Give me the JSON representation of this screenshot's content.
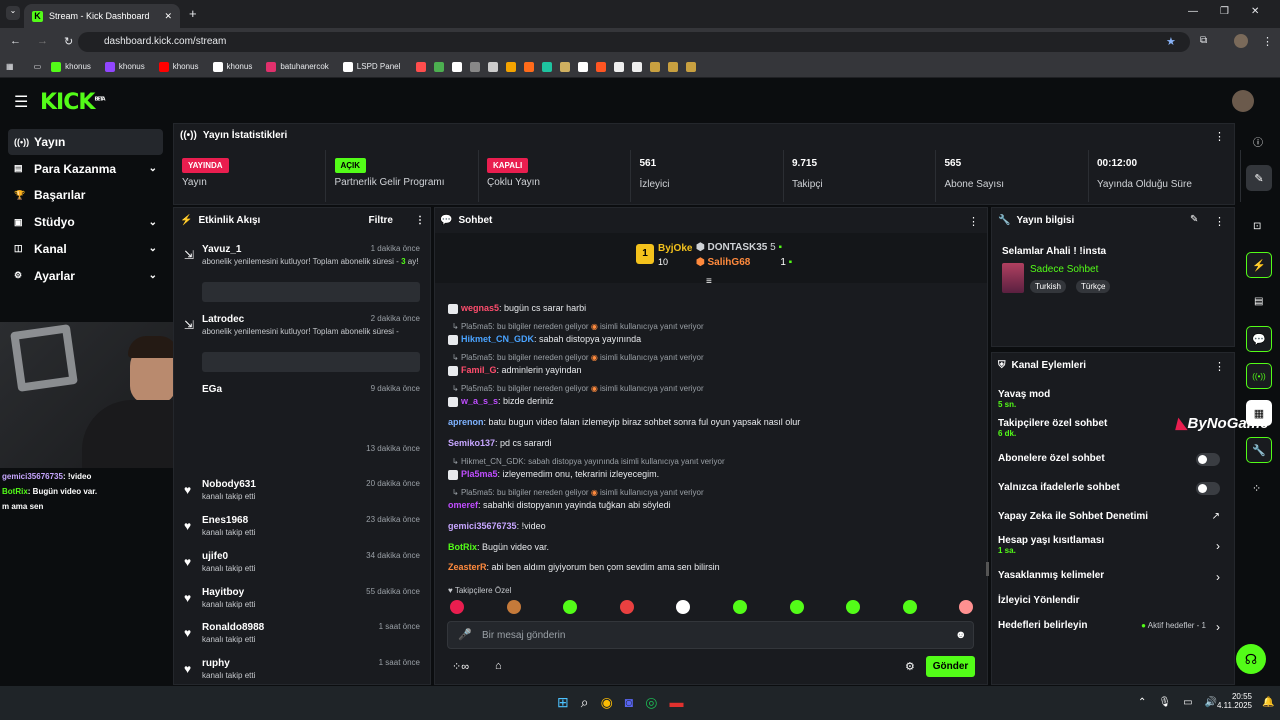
{
  "browser": {
    "tab_title": "Stream - Kick Dashboard",
    "url": "dashboard.kick.com/stream",
    "bookmarks": [
      {
        "label": "khonus",
        "color": "#53fc18"
      },
      {
        "label": "khonus",
        "color": "#9146ff"
      },
      {
        "label": "khonus",
        "color": "#ff0000"
      },
      {
        "label": "khonus",
        "color": "#ffffff"
      },
      {
        "label": "batuhanercok",
        "color": "#e1306c"
      },
      {
        "label": "LSPD Panel",
        "color": "#ffffff"
      }
    ]
  },
  "brand": {
    "logo": "KICK",
    "beta": "BETA"
  },
  "sidebar": [
    {
      "label": "Yayın",
      "icon": "broadcast-icon",
      "chev": false
    },
    {
      "label": "Para Kazanma",
      "icon": "money-icon",
      "chev": true
    },
    {
      "label": "Başarılar",
      "icon": "trophy-icon",
      "chev": false
    },
    {
      "label": "Stüdyo",
      "icon": "studio-icon",
      "chev": true
    },
    {
      "label": "Kanal",
      "icon": "channel-icon",
      "chev": true
    },
    {
      "label": "Ayarlar",
      "icon": "gear-icon",
      "chev": true
    }
  ],
  "stats": {
    "title": "Yayın İstatistikleri",
    "items": [
      {
        "badge": "YAYINDA",
        "badge_color": "#e91e4f",
        "label": "Yayın"
      },
      {
        "badge": "AÇIK",
        "badge_color": "#53fc18",
        "label": "Partnerlik Gelir Programı"
      },
      {
        "badge": "KAPALI",
        "badge_color": "#e91e4f",
        "label": "Çoklu Yayın"
      },
      {
        "value": "561",
        "label": "İzleyici"
      },
      {
        "value": "9.715",
        "label": "Takipçi"
      },
      {
        "value": "565",
        "label": "Abone Sayısı"
      },
      {
        "value": "00:12:00",
        "label": "Yayında Olduğu Süre"
      }
    ]
  },
  "activity": {
    "title": "Etkinlik Akışı",
    "filter": "Filtre",
    "items": [
      {
        "name": "Yavuz_1",
        "time": "1 dakika önce",
        "sub": "abonelik yenilemesini kutluyor! Toplam abonelik süresi -",
        "months": "3",
        "ay": "ay!"
      },
      {
        "name": "Latrodec",
        "time": "2 dakika önce",
        "sub": "abonelik yenilemesini kutluyor! Toplam abonelik süresi -"
      },
      {
        "name": "EGa",
        "time": "9 dakika önce"
      },
      {
        "name": "",
        "time": "13 dakika önce"
      },
      {
        "name": "Nobody631",
        "time": "20 dakika önce",
        "sub": "kanalı takip etti"
      },
      {
        "name": "Enes1968",
        "time": "23 dakika önce",
        "sub": "kanalı takip etti"
      },
      {
        "name": "ujife0",
        "time": "34 dakika önce",
        "sub": "kanalı takip etti"
      },
      {
        "name": "Hayitboy",
        "time": "55 dakika önce",
        "sub": "kanalı takip etti"
      },
      {
        "name": "Ronaldo8988",
        "time": "1 saat önce",
        "sub": "kanalı takip etti"
      },
      {
        "name": "ruphy",
        "time": "1 saat önce",
        "sub": "kanalı takip etti"
      }
    ]
  },
  "overlay_chat": [
    {
      "user": "gemici35676735",
      "text": ": !video"
    },
    {
      "user": "BotRix",
      "text": ": Bugün video var."
    },
    {
      "user": "",
      "text": "m ama sen"
    }
  ],
  "chat": {
    "title": "Sohbet",
    "top": [
      {
        "name": "ByjOke",
        "count": "10"
      },
      {
        "name": "DONTASK35",
        "count": "5"
      },
      {
        "name": "SalihG68",
        "count": "1"
      }
    ],
    "messages": [
      {
        "user": "wegnas5",
        "color": "#ff4d6d",
        "text": ": bugün cs sarar harbi"
      },
      {
        "reply": "Pla5ma5: bu bilgiler nereden geliyor",
        "reply2": "isimli kullanıcıya yanıt veriyor"
      },
      {
        "user": "Hikmet_CN_GDK",
        "color": "#4aa3ff",
        "text": ": sabah distopya yayınında"
      },
      {
        "reply": "Pla5ma5: bu bilgiler nereden geliyor",
        "reply2": "isimli kullanıcıya yanıt veriyor"
      },
      {
        "user": "Famil_G",
        "color": "#ff4d6d",
        "text": ": adminlerin yayindan"
      },
      {
        "reply": "Pla5ma5: bu bilgiler nereden geliyor",
        "reply2": "isimli kullanıcıya yanıt veriyor"
      },
      {
        "user": "w_a_s_s",
        "color": "#c04dff",
        "text": ": bizde deriniz"
      },
      {
        "user": "aprenon",
        "color": "#7fb3ff",
        "text": ": batu bugun video falan izlemeyip biraz sohbet sonra ful oyun yapsak nasıl olur"
      },
      {
        "user": "Semiko137",
        "color": "#c7a6ff",
        "text": ": pd cs sarardi"
      },
      {
        "reply": "Hikmet_CN_GDK: sabah distopya yayınında isimli kullanıcıya yanıt veriyor"
      },
      {
        "user": "Pla5ma5",
        "color": "#c04dff",
        "text": ": izleyemedim onu, tekrarini izleyecegim."
      },
      {
        "reply": "Pla5ma5: bu bilgiler nereden geliyor",
        "reply2": "isimli kullanıcıya yanıt veriyor"
      },
      {
        "user": "omeref",
        "color": "#c04dff",
        "text": ": sabahki distopyanın yayinda tuğkan abi söyledi"
      },
      {
        "user": "gemici35676735",
        "color": "#c7a6ff",
        "text": ": !video"
      },
      {
        "user": "BotRix",
        "color": "#53fc18",
        "text": ": Bugün video var."
      },
      {
        "user": "ZeasterR",
        "color": "#ff8a3d",
        "text": ": abi ben aldım giyiyorum ben çom sevdim ama sen bilirsin"
      }
    ],
    "followers_label": "Takipçilere Özel",
    "placeholder": "Bir mesaj gönderin",
    "send": "Gönder"
  },
  "stream_info": {
    "title": "Yayın bilgisi",
    "stream_title": "Selamlar Ahali ! !insta",
    "category": "Sadece Sohbet",
    "tags": [
      "Turkish",
      "Türkçe"
    ]
  },
  "channel_actions": {
    "title": "Kanal Eylemleri",
    "items": [
      {
        "label": "Yavaş mod",
        "sub": "5 sn."
      },
      {
        "label": "Takipçilere özel sohbet",
        "sub": "6 dk."
      },
      {
        "label": "Abonelere özel sohbet",
        "toggle": true
      },
      {
        "label": "Yalnızca ifadelerle sohbet",
        "toggle": true
      },
      {
        "label": "Yapay Zeka ile Sohbet Denetimi"
      },
      {
        "label": "Hesap yaşı kısıtlaması",
        "sub": "1 sa."
      },
      {
        "label": "Yasaklanmış kelimeler"
      },
      {
        "label": "İzleyici Yönlendir"
      },
      {
        "label": "Hedefleri belirleyin",
        "extra": "Aktif hedefler - 1"
      }
    ]
  },
  "watermark": "ByNoGame",
  "taskbar": {
    "time": "20:55",
    "date": "4.11.2025"
  }
}
